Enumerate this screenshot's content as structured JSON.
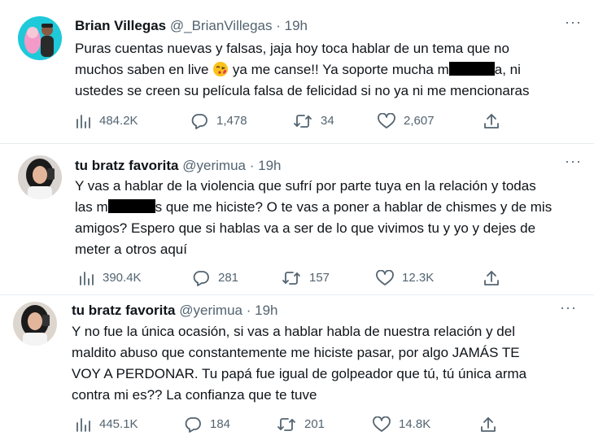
{
  "tweets": [
    {
      "name": "Brian Villegas",
      "handle": "@_BrianVillegas",
      "dot": "·",
      "time": "19h",
      "more": "···",
      "line1": "Puras cuentas nuevas y falsas, jaja hoy toca hablar de un tema que no",
      "line2a": "muchos saben en live",
      "line2b": "ya me canse!! Ya soporte mucha m",
      "line2c": "a, ni",
      "line3": "ustedes se creen su película falsa de felicidad si no ya ni me mencionaras",
      "views": "484.2K",
      "replies": "1,478",
      "retweets": "34",
      "likes": "2,607"
    },
    {
      "name": "tu bratz favorita",
      "handle": "@yerimua",
      "dot": "·",
      "time": "19h",
      "more": "···",
      "line1": "Y vas a hablar de la violencia que sufrí por parte tuya en la relación y todas",
      "line2a": "las m",
      "line2b": "s que me hiciste? O te vas a poner a hablar de chismes y de mis",
      "line3": "amigos? Espero que si hablas va a ser de lo que vivimos tu y yo y dejes de",
      "line4": "meter a otros aquí",
      "views": "390.4K",
      "replies": "281",
      "retweets": "157",
      "likes": "12.3K"
    },
    {
      "name": "tu bratz favorita",
      "handle": "@yerimua",
      "dot": "·",
      "time": "19h",
      "more": "···",
      "line1": "Y no fue la única ocasión, si vas a hablar habla de nuestra relación y del",
      "line2": "maldito abuso que constantemente me hiciste pasar, por algo JAMÁS TE",
      "line3": "VOY A PERDONAR. Tu papá fue igual de golpeador que tú, tú única arma",
      "line4": "contra mi es?? La confianza que te tuve",
      "views": "445.1K",
      "replies": "184",
      "retweets": "201",
      "likes": "14.8K"
    }
  ],
  "icons": {
    "views": "views-chart-icon",
    "reply": "reply-bubble-icon",
    "retweet": "retweet-arrows-icon",
    "like": "heart-icon",
    "share": "share-upload-icon",
    "emoji": "face-blowing-kiss-emoji"
  },
  "colors": {
    "text": "#0f1419",
    "secondary": "#536471",
    "divider": "#e6ecf0"
  }
}
